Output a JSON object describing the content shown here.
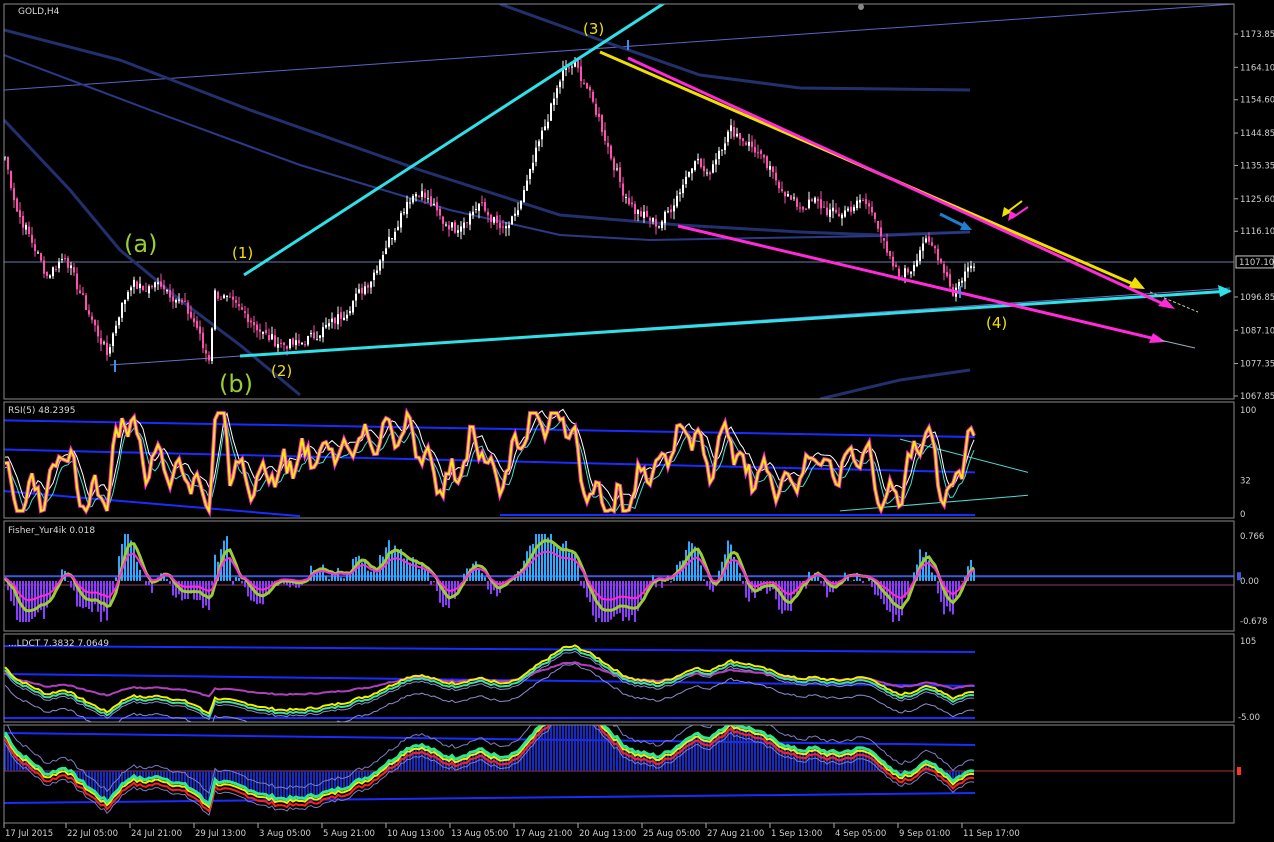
{
  "chart_data": {
    "type": "candlestick",
    "symbol_label": "GOLD,H4",
    "x_labels": [
      "17 Jul 2015",
      "22 Jul 05:00",
      "24 Jul 21:00",
      "29 Jul 13:00",
      "3 Aug 05:00",
      "5 Aug 21:00",
      "10 Aug 13:00",
      "13 Aug 05:00",
      "17 Aug 21:00",
      "20 Aug 13:00",
      "25 Aug 05:00",
      "27 Aug 21:00",
      "1 Sep 13:00",
      "4 Sep 05:00",
      "9 Sep 01:00",
      "11 Sep 17:00"
    ],
    "price": {
      "y_ticks": [
        "1173.85",
        "1164.10",
        "1154.60",
        "1144.85",
        "1135.35",
        "1125.60",
        "1116.10",
        "1096.85",
        "1087.10",
        "1077.35",
        "1067.85"
      ],
      "ylim": [
        1064,
        1183
      ],
      "current_price": "1107.10",
      "close_path": [
        [
          0,
          1138
        ],
        [
          4,
          1122
        ],
        [
          8,
          1115
        ],
        [
          14,
          1103
        ],
        [
          20,
          1109
        ],
        [
          26,
          1096
        ],
        [
          30,
          1088
        ],
        [
          34,
          1080
        ],
        [
          38,
          1092
        ],
        [
          42,
          1101
        ],
        [
          46,
          1099
        ],
        [
          52,
          1101
        ],
        [
          56,
          1097
        ],
        [
          60,
          1094
        ],
        [
          64,
          1088
        ],
        [
          66,
          1082
        ],
        [
          68,
          1079
        ],
        [
          70,
          1098
        ],
        [
          74,
          1096
        ],
        [
          80,
          1092
        ],
        [
          86,
          1086
        ],
        [
          92,
          1083
        ],
        [
          98,
          1083
        ],
        [
          104,
          1086
        ],
        [
          110,
          1090
        ],
        [
          114,
          1093
        ],
        [
          118,
          1098
        ],
        [
          122,
          1102
        ],
        [
          126,
          1110
        ],
        [
          130,
          1117
        ],
        [
          134,
          1125
        ],
        [
          138,
          1128
        ],
        [
          142,
          1124
        ],
        [
          146,
          1119
        ],
        [
          150,
          1117
        ],
        [
          154,
          1120
        ],
        [
          158,
          1124
        ],
        [
          162,
          1120
        ],
        [
          166,
          1116
        ],
        [
          170,
          1120
        ],
        [
          174,
          1130
        ],
        [
          178,
          1142
        ],
        [
          182,
          1152
        ],
        [
          186,
          1163
        ],
        [
          190,
          1165
        ],
        [
          194,
          1158
        ],
        [
          198,
          1149
        ],
        [
          202,
          1138
        ],
        [
          206,
          1128
        ],
        [
          210,
          1122
        ],
        [
          214,
          1120
        ],
        [
          218,
          1118
        ],
        [
          222,
          1123
        ],
        [
          226,
          1130
        ],
        [
          230,
          1138
        ],
        [
          234,
          1132
        ],
        [
          238,
          1140
        ],
        [
          242,
          1146
        ],
        [
          246,
          1143
        ],
        [
          250,
          1140
        ],
        [
          254,
          1135
        ],
        [
          258,
          1130
        ],
        [
          262,
          1125
        ],
        [
          266,
          1123
        ],
        [
          270,
          1125
        ],
        [
          274,
          1122
        ],
        [
          278,
          1121
        ],
        [
          282,
          1123
        ],
        [
          286,
          1125
        ],
        [
          290,
          1121
        ],
        [
          294,
          1109
        ],
        [
          298,
          1103
        ],
        [
          302,
          1105
        ],
        [
          306,
          1113
        ],
        [
          310,
          1111
        ],
        [
          314,
          1103
        ],
        [
          316,
          1098
        ],
        [
          320,
          1104
        ],
        [
          323,
          1107
        ]
      ],
      "wave_labels": [
        "(a)",
        "(1)",
        "(2)",
        "(b)",
        "(3)",
        "(4)"
      ]
    },
    "rsi": {
      "label": "RSI(5) 48.2395",
      "y_ticks": [
        "100",
        "32",
        "0"
      ],
      "ylim": [
        0,
        100
      ]
    },
    "fisher": {
      "label": "Fisher_Yur4ik 0.018",
      "y_ticks": [
        "0.766",
        "0.00",
        "-0.678"
      ],
      "ylim": [
        -0.8,
        0.9
      ]
    },
    "fourth": {
      "label": "...LDCT 7.3832 7.0649",
      "y_ticks": [
        "105",
        "-5.00"
      ]
    },
    "fifth": {
      "label": "",
      "y_ticks": []
    }
  }
}
